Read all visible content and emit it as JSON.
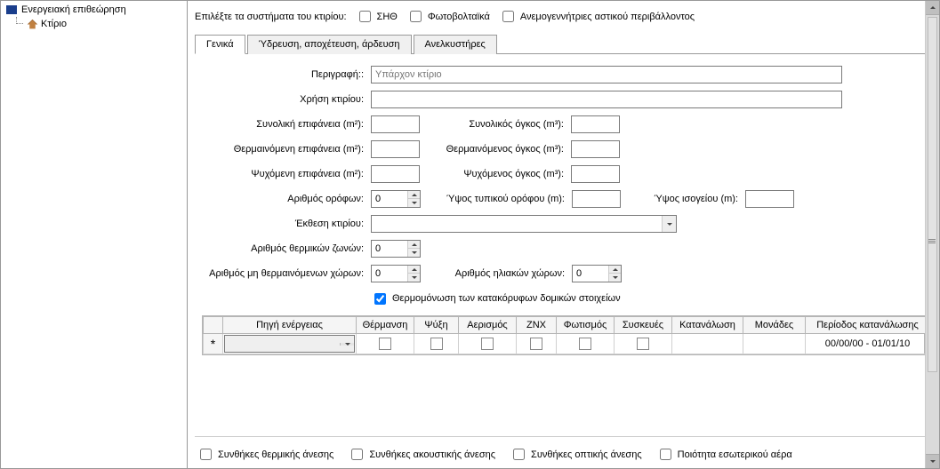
{
  "tree": {
    "root_label": "Ενεργειακή επιθεώρηση",
    "child_label": "Κτίριο"
  },
  "systems": {
    "prompt": "Επιλέξτε τα συστήματα του κτιρίου:",
    "opt1": "ΣΗΘ",
    "opt2": "Φωτοβολταϊκά",
    "opt3": "Ανεμογεννήτριες αστικού περιβάλλοντος"
  },
  "tabs": {
    "t1": "Γενικά",
    "t2": "Ύδρευση, αποχέτευση, άρδευση",
    "t3": "Ανελκυστήρες"
  },
  "labels": {
    "desc": "Περιγραφή::",
    "desc_ph": "Υπάρχον κτίριο",
    "use": "Χρήση κτιρίου:",
    "total_area": "Συνολική επιφάνεια (m²):",
    "total_vol": "Συνολικός όγκος (m³):",
    "heated_area": "Θερμαινόμενη επιφάνεια (m²):",
    "heated_vol": "Θερμαινόμενος όγκος (m³):",
    "cooled_area": "Ψυχόμενη επιφάνεια (m²):",
    "cooled_vol": "Ψυχόμενος όγκος (m³):",
    "floors": "Αριθμός ορόφων:",
    "floor_h": "Ύψος τυπικού ορόφου (m):",
    "ground_h": "Ύψος ισογείου (m):",
    "exposure": "Έκθεση κτιρίου:",
    "thermal_zones": "Αριθμός θερμικών ζωνών:",
    "unheated_spaces": "Αριθμός μη θερμαινόμενων χώρων:",
    "sunspaces": "Αριθμός ηλιακών χώρων:",
    "insulation": "Θερμομόνωση των  κατακόρυφων δομικών στοιχείων"
  },
  "spin": {
    "floors": "0",
    "tz": "0",
    "us": "0",
    "ss": "0"
  },
  "grid": {
    "h1": "Πηγή ενέργειας",
    "h2": "Θέρμανση",
    "h3": "Ψύξη",
    "h4": "Αερισμός",
    "h5": "ΖΝΧ",
    "h6": "Φωτισμός",
    "h7": "Συσκευές",
    "h8": "Κατανάλωση",
    "h9": "Μονάδες",
    "h10": "Περίοδος κατανάλωσης",
    "period": "00/00/00 - 01/01/10"
  },
  "footer": {
    "f1": "Συνθήκες θερμικής άνεσης",
    "f2": "Συνθήκες ακουστικής άνεσης",
    "f3": "Συνθήκες οπτικής άνεσης",
    "f4": "Ποιότητα εσωτερικού αέρα"
  }
}
